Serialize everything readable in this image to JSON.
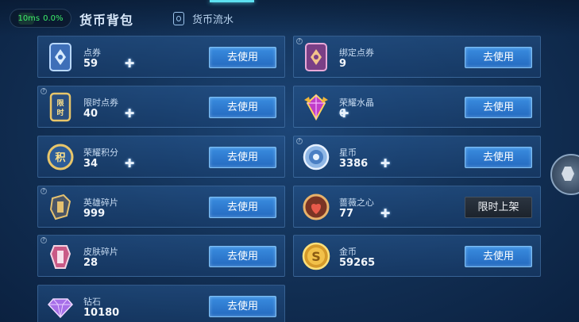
{
  "status": {
    "ping": "10ms",
    "loss": "0.0%"
  },
  "header": {
    "title": "货币背包",
    "flow_label": "货币流水"
  },
  "colors": {
    "button_blue": "#2f7dd6",
    "accent_cyan": "#5de0f0",
    "ping_green": "#3df06a",
    "limited_dark": "#232b35"
  },
  "items": [
    {
      "name": "点券",
      "value": "59",
      "icon": "voucher-icon",
      "has_plus": true,
      "button": "去使用",
      "corner": false
    },
    {
      "name": "绑定点券",
      "value": "9",
      "icon": "bound-voucher-icon",
      "has_plus": false,
      "button": "去使用",
      "corner": true
    },
    {
      "name": "限时点券",
      "value": "40",
      "icon": "limited-voucher-icon",
      "has_plus": true,
      "button": "去使用",
      "corner": true
    },
    {
      "name": "荣耀水晶",
      "value": "0",
      "icon": "glory-crystal-icon",
      "has_plus": true,
      "button": "去使用",
      "corner": false
    },
    {
      "name": "荣耀积分",
      "value": "34",
      "icon": "glory-points-icon",
      "has_plus": true,
      "button": "去使用",
      "corner": false
    },
    {
      "name": "星币",
      "value": "3386",
      "icon": "star-coin-icon",
      "has_plus": true,
      "button": "去使用",
      "corner": true
    },
    {
      "name": "英雄碎片",
      "value": "999",
      "icon": "hero-fragment-icon",
      "has_plus": false,
      "button": "去使用",
      "corner": true
    },
    {
      "name": "蔷薇之心",
      "value": "77",
      "icon": "rose-heart-icon",
      "has_plus": true,
      "button": "限时上架",
      "corner": false
    },
    {
      "name": "皮肤碎片",
      "value": "28",
      "icon": "skin-fragment-icon",
      "has_plus": false,
      "button": "去使用",
      "corner": true
    },
    {
      "name": "金币",
      "value": "59265",
      "icon": "gold-coin-icon",
      "has_plus": false,
      "button": "去使用",
      "corner": false
    },
    {
      "name": "钻石",
      "value": "10180",
      "icon": "diamond-icon",
      "has_plus": false,
      "button": "去使用",
      "corner": false
    }
  ]
}
